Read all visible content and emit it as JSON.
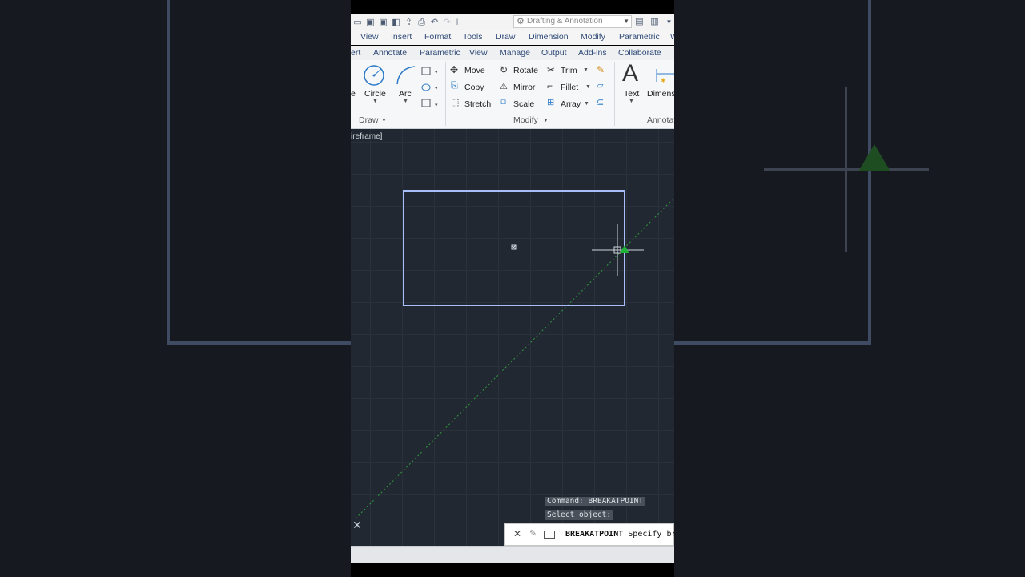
{
  "quick_access": {
    "workspace": "Drafting & Annotation",
    "icons": [
      "new-icon",
      "save-icon",
      "save-as-icon",
      "open-web-icon",
      "publish-icon",
      "print-icon",
      "undo-icon",
      "redo-icon",
      "match-properties-icon"
    ]
  },
  "menubar": {
    "items": [
      "View",
      "Insert",
      "Format",
      "Tools",
      "Draw",
      "Dimension",
      "Modify",
      "Parametric",
      "W"
    ]
  },
  "ribbon_tabs": {
    "items": [
      "ert",
      "Annotate",
      "Parametric",
      "View",
      "Manage",
      "Output",
      "Add-ins",
      "Collaborate"
    ]
  },
  "ribbon": {
    "draw": {
      "title": "Draw",
      "line_label": "e",
      "circle_label": "Circle",
      "arc_label": "Arc"
    },
    "modify": {
      "title": "Modify",
      "move": "Move",
      "copy": "Copy",
      "stretch": "Stretch",
      "rotate": "Rotate",
      "mirror": "Mirror",
      "scale": "Scale",
      "trim": "Trim",
      "fillet": "Fillet",
      "array": "Array"
    },
    "annotation": {
      "title": "Annotat",
      "text_label": "Text",
      "dimension_label": "Dimens"
    }
  },
  "viewport": {
    "label": "ireframe]"
  },
  "command": {
    "history": [
      "Command: BREAKATPOINT",
      "Select object:"
    ],
    "current_command": "BREAKATPOINT",
    "prompt": "Specify br"
  },
  "colors": {
    "canvas_bg": "#222831",
    "rectangle_selected": "#9fb6ff",
    "snap_marker": "#1fb33a",
    "ribbon_text": "#2f4a77"
  }
}
